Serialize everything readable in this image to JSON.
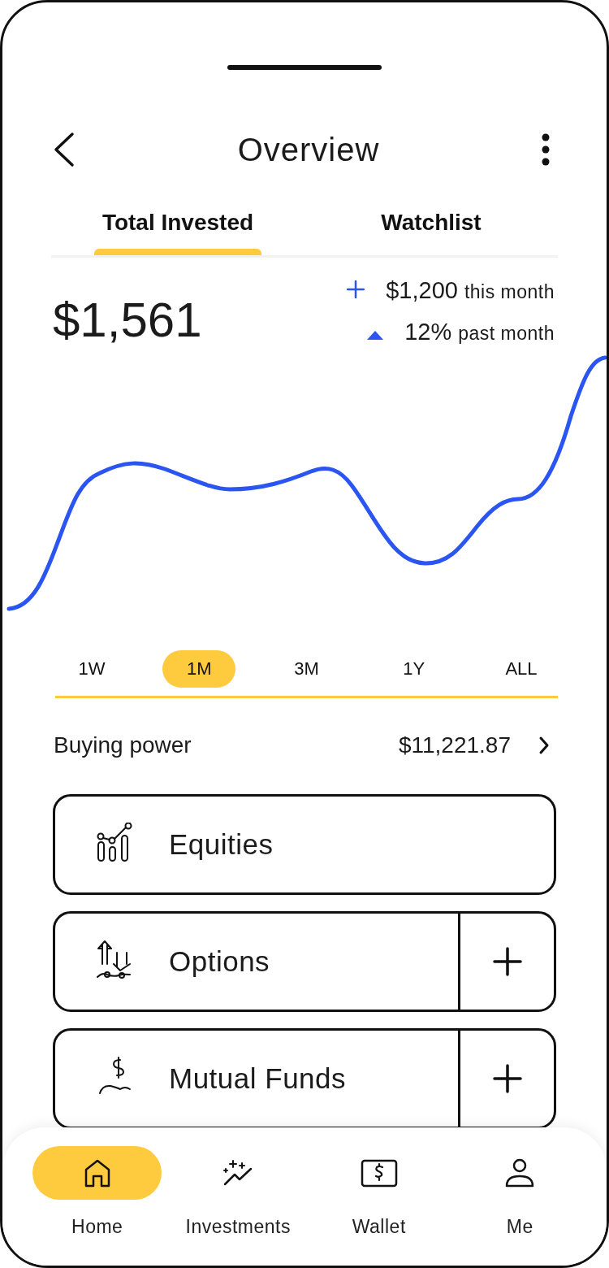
{
  "header": {
    "title": "Overview"
  },
  "tabs": [
    {
      "label": "Total Invested",
      "selected": true
    },
    {
      "label": "Watchlist",
      "selected": false
    }
  ],
  "summary": {
    "total": "$1,561",
    "stats": [
      {
        "kind": "plus",
        "value": "$1,200",
        "label": "this month"
      },
      {
        "kind": "up",
        "value": "12%",
        "label": "past month"
      }
    ]
  },
  "ranges": [
    {
      "label": "1W",
      "selected": false
    },
    {
      "label": "1M",
      "selected": true
    },
    {
      "label": "3M",
      "selected": false
    },
    {
      "label": "1Y",
      "selected": false
    },
    {
      "label": "ALL",
      "selected": false
    }
  ],
  "buying_power": {
    "label": "Buying power",
    "value": "$11,221.87"
  },
  "categories": [
    {
      "label": "Equities",
      "kind": "plain"
    },
    {
      "label": "Options",
      "kind": "addable"
    },
    {
      "label": "Mutual Funds",
      "kind": "addable"
    }
  ],
  "nav": [
    {
      "label": "Home",
      "selected": true
    },
    {
      "label": "Investments",
      "selected": false
    },
    {
      "label": "Wallet",
      "selected": false
    },
    {
      "label": "Me",
      "selected": false
    }
  ]
}
